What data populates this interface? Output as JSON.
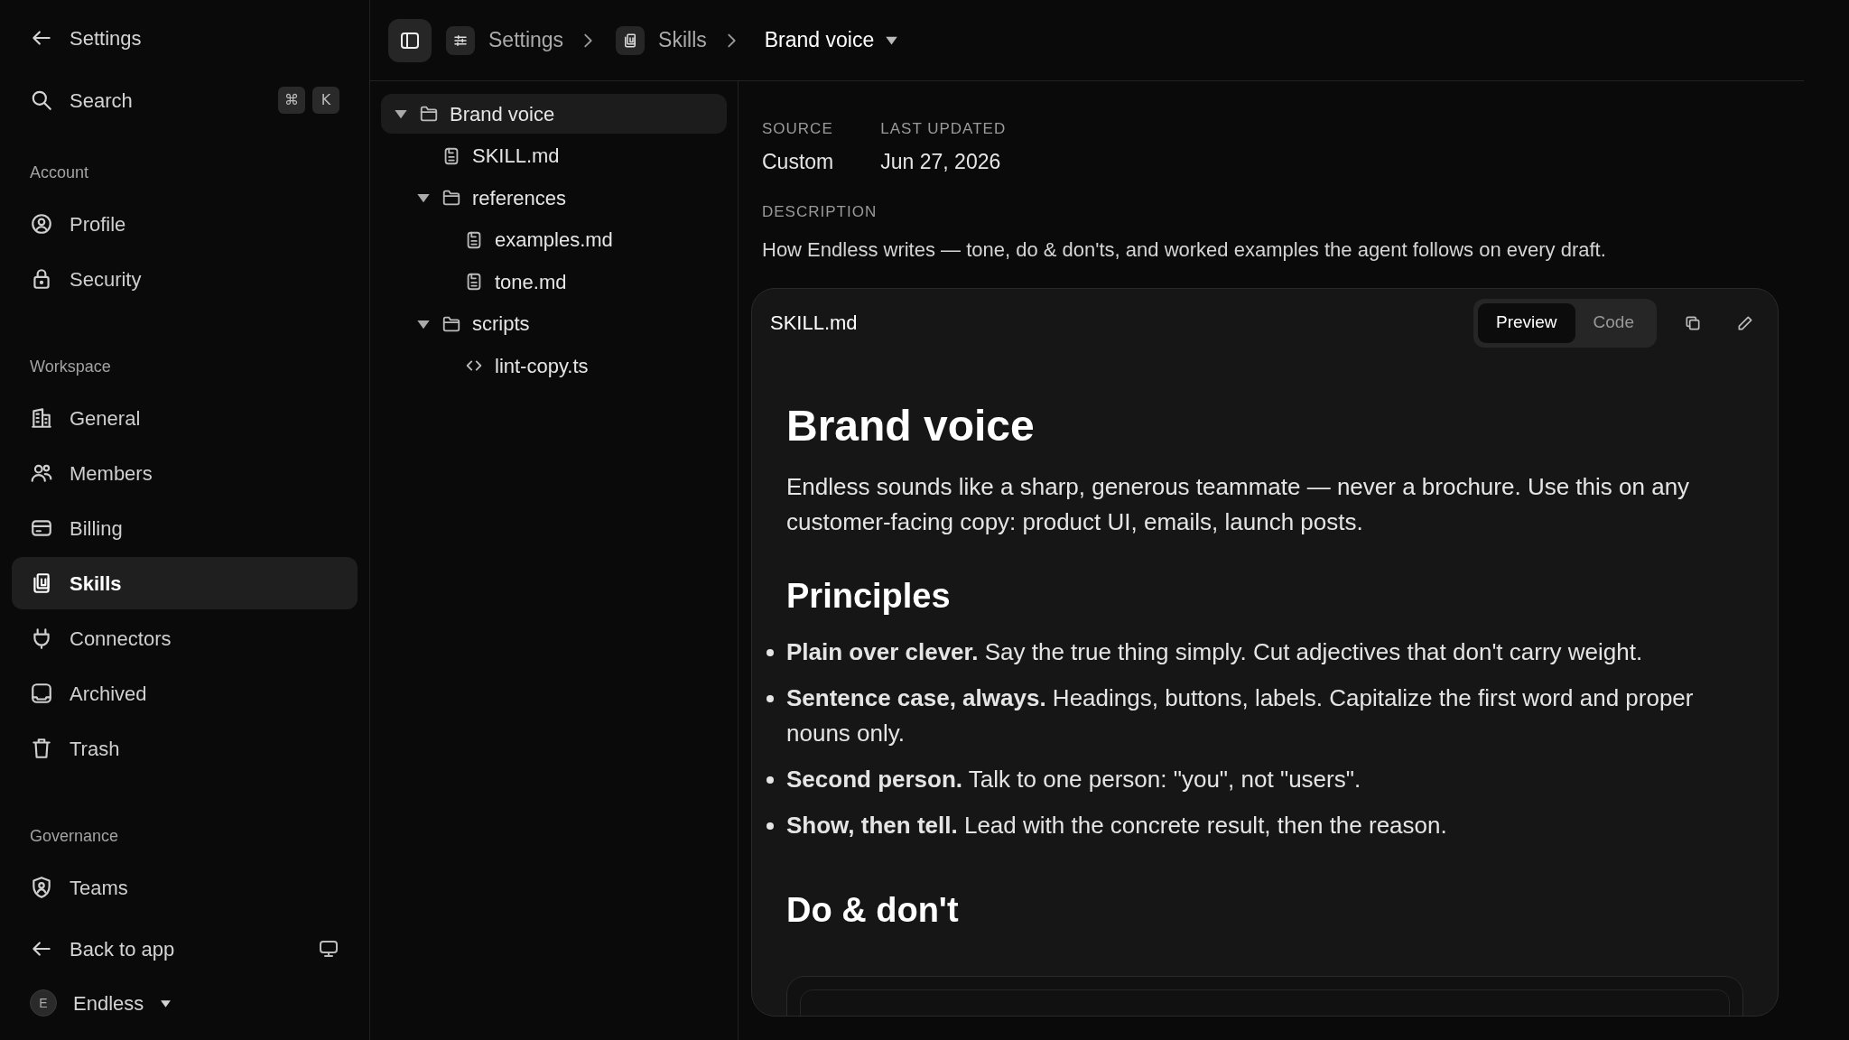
{
  "sidebar": {
    "back": "Settings",
    "search": {
      "label": "Search",
      "keys": [
        "⌘",
        "K"
      ]
    },
    "groups": [
      {
        "heading": "Account",
        "items": [
          {
            "label": "Profile",
            "selected": false
          },
          {
            "label": "Security",
            "selected": false
          }
        ]
      },
      {
        "heading": "Workspace",
        "items": [
          {
            "label": "General",
            "selected": false
          },
          {
            "label": "Members",
            "selected": false
          },
          {
            "label": "Billing",
            "selected": false
          },
          {
            "label": "Skills",
            "selected": true
          },
          {
            "label": "Connectors",
            "selected": false
          },
          {
            "label": "Archived",
            "selected": false
          },
          {
            "label": "Trash",
            "selected": false
          }
        ]
      },
      {
        "heading": "Governance",
        "items": [
          {
            "label": "Teams",
            "selected": false
          }
        ]
      }
    ],
    "back_to_app": "Back to app",
    "workspace": {
      "initial": "E",
      "name": "Endless"
    }
  },
  "breadcrumb": [
    "Settings",
    "Skills",
    "Brand voice"
  ],
  "tree": [
    {
      "label": "Brand voice",
      "kind": "folder",
      "expanded": true,
      "selected": true,
      "children": [
        {
          "label": "SKILL.md",
          "kind": "doc",
          "selected": false
        },
        {
          "label": "references",
          "kind": "folder",
          "expanded": true,
          "selected": false,
          "children": [
            {
              "label": "examples.md",
              "kind": "doc",
              "selected": false
            },
            {
              "label": "tone.md",
              "kind": "doc",
              "selected": false
            }
          ]
        },
        {
          "label": "scripts",
          "kind": "folder",
          "expanded": true,
          "selected": false,
          "children": [
            {
              "label": "lint-copy.ts",
              "kind": "code",
              "selected": false
            }
          ]
        }
      ]
    }
  ],
  "meta": [
    {
      "label": "SOURCE",
      "value": "Custom"
    },
    {
      "label": "LAST UPDATED",
      "value": "Jun 27, 2026"
    }
  ],
  "description": {
    "label": "DESCRIPTION",
    "text": "How Endless writes — tone, do & don'ts, and worked examples the agent follows on every draft."
  },
  "file": {
    "name": "SKILL.md",
    "tabs": [
      {
        "label": "Preview",
        "selected": true
      },
      {
        "label": "Code",
        "selected": false
      }
    ],
    "doc": [
      {
        "kind": "h1",
        "text": "Brand voice"
      },
      {
        "kind": "p",
        "text": "Endless sounds like a sharp, generous teammate — never a brochure. Use this on any customer-facing copy: product UI, emails, launch posts."
      },
      {
        "kind": "h2",
        "text": "Principles"
      },
      {
        "kind": "bullets",
        "items": [
          "**Plain over clever.** Say the true thing simply. Cut adjectives that don't carry weight.",
          "**Sentence case, always.** Headings, buttons, labels. Capitalize the first word and proper nouns only.",
          "**Second person.** Talk to one person: \"you\", not \"users\".",
          "**Show, then tell.** Lead with the concrete result, then the reason."
        ]
      },
      {
        "kind": "h2",
        "text": "Do & don't"
      },
      {
        "kind": "table"
      }
    ]
  }
}
